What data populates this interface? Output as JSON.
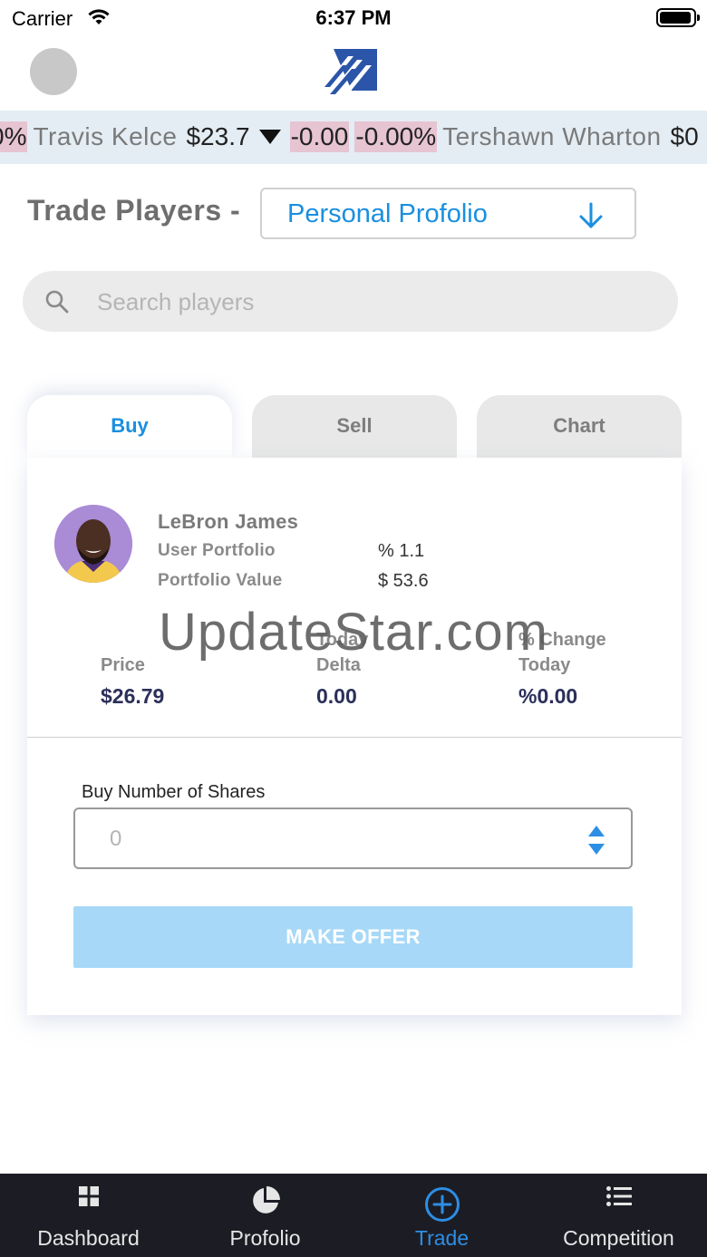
{
  "status_bar": {
    "carrier": "Carrier",
    "time": "6:37 PM"
  },
  "ticker": {
    "lead_fragment": "0%",
    "items": [
      {
        "name": "Travis Kelce",
        "price": "$23.7",
        "delta": "-0.00",
        "pct": "-0.00%",
        "direction": "down"
      },
      {
        "name": "Tershawn Wharton",
        "price": "$0"
      }
    ]
  },
  "trade": {
    "label": "Trade Players -",
    "portfolio_selected": "Personal Profolio"
  },
  "search": {
    "placeholder": "Search players"
  },
  "tabs": [
    {
      "label": "Buy",
      "active": true
    },
    {
      "label": "Sell",
      "active": false
    },
    {
      "label": "Chart",
      "active": false
    }
  ],
  "player": {
    "name": "LeBron James",
    "user_portfolio_label": "User Portfolio",
    "user_portfolio_value": "% 1.1",
    "portfolio_value_label": "Portfolio Value",
    "portfolio_value": "$ 53.6"
  },
  "stats": {
    "price_label": "Price",
    "price_value": "$26.79",
    "delta_label_1": "Today",
    "delta_label_2": "Delta",
    "delta_value": "0.00",
    "change_label_1": "% Change",
    "change_label_2": "Today",
    "change_value": "%0.00"
  },
  "buy_form": {
    "shares_label": "Buy Number of Shares",
    "shares_value": "0",
    "offer_button": "MAKE OFFER"
  },
  "watermark": "UpdateStar.com",
  "bottom_nav": [
    {
      "label": "Dashboard",
      "icon": "grid-icon",
      "active": false
    },
    {
      "label": "Profolio",
      "icon": "pie-chart-icon",
      "active": false
    },
    {
      "label": "Trade",
      "icon": "plus-circle-icon",
      "active": true
    },
    {
      "label": "Competition",
      "icon": "list-icon",
      "active": false
    }
  ],
  "colors": {
    "accent": "#1a8fe0",
    "nav_bg": "#1c1d24",
    "ticker_bg": "#e4edf4",
    "ticker_highlight": "#e6c4d2",
    "offer_button_bg": "#a7d8f7",
    "stat_value": "#2b2f5a"
  }
}
